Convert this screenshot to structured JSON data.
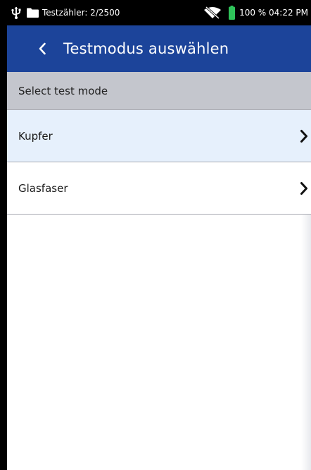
{
  "status_bar": {
    "counter": "Testzähler: 2/2500",
    "battery_time": "100 % 04:22 PM",
    "icons": [
      "usb-icon",
      "folder-icon",
      "wifi-off-icon",
      "battery-icon"
    ],
    "battery_level": 1.0
  },
  "app_bar": {
    "title": "Testmodus auswählen",
    "back_icon": "back-icon",
    "color": "#1c449a"
  },
  "section": {
    "header": "Select test mode"
  },
  "items": [
    {
      "label": "Kupfer",
      "icon": "chevron-right-icon",
      "selected": true
    },
    {
      "label": "Glasfaser",
      "icon": "chevron-right-icon",
      "selected": false
    }
  ],
  "colors": {
    "header_bg": "#c4c6cd",
    "selected_bg": "#e6f0fc",
    "battery": "#2fc35a"
  }
}
